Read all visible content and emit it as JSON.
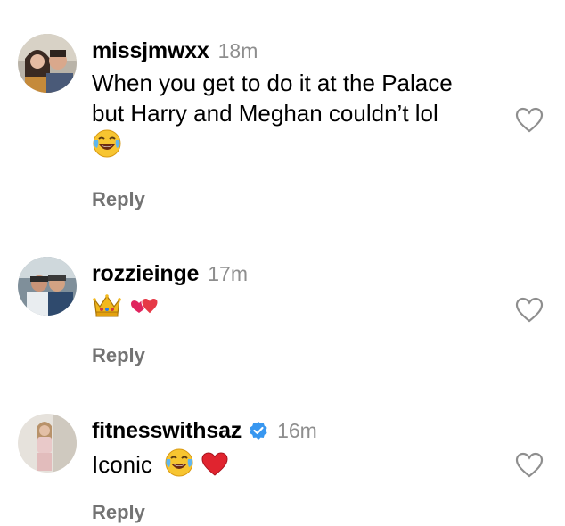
{
  "comments": [
    {
      "username": "missjmwxx",
      "time": "18m",
      "text_line1": "When you get to do it at the Palace",
      "text_line2": "but Harry and Meghan couldn’t lol",
      "emojis": [
        "face-with-tears-of-joy"
      ],
      "verified": false,
      "reply_label": "Reply"
    },
    {
      "username": "rozzieinge",
      "time": "17m",
      "text": "",
      "emojis": [
        "crown",
        "two-hearts"
      ],
      "verified": false,
      "reply_label": "Reply"
    },
    {
      "username": "fitnesswithsaz",
      "time": "16m",
      "text": "Iconic",
      "emojis": [
        "face-with-tears-of-joy",
        "red-heart"
      ],
      "verified": true,
      "reply_label": "Reply"
    }
  ],
  "colors": {
    "muted": "#8e8e8e",
    "reply": "#737373",
    "verified": "#3897f0",
    "heart_outline": "#8e8e8e"
  }
}
